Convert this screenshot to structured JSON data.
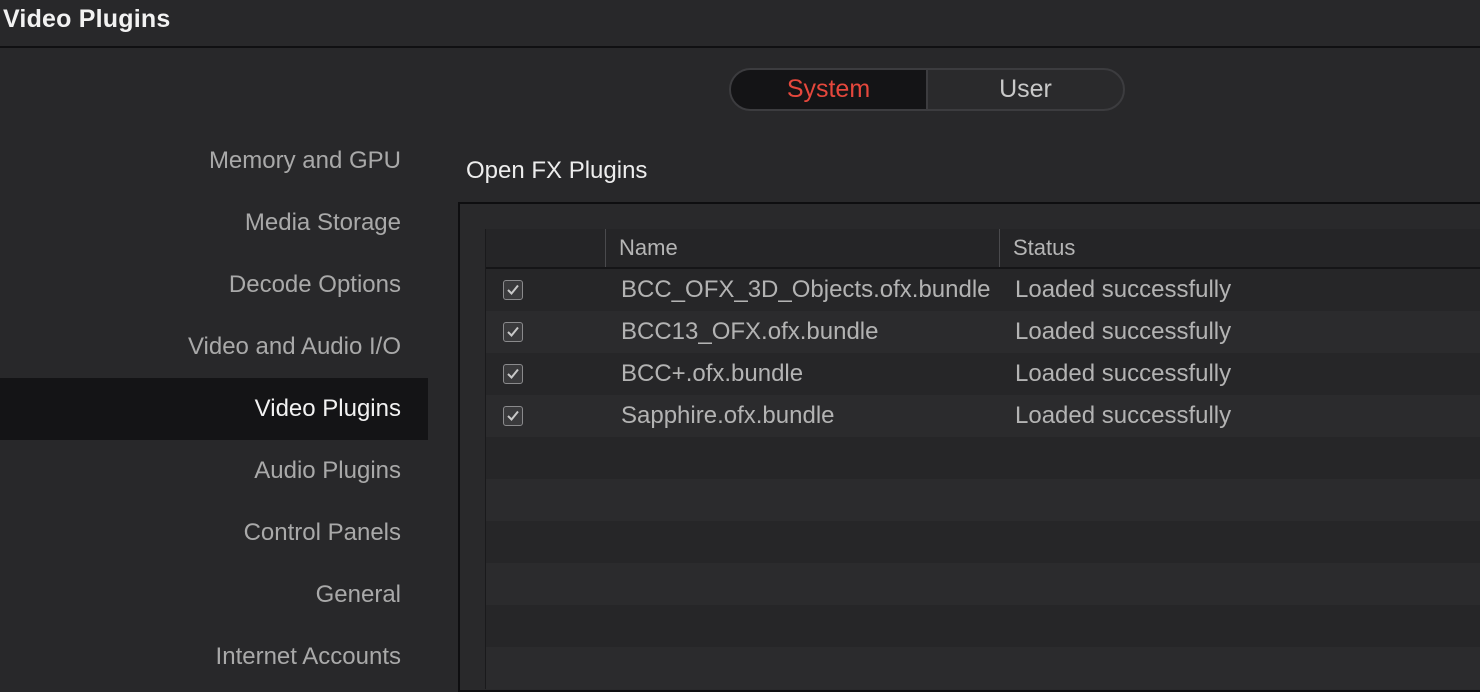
{
  "window": {
    "title": "Video Plugins"
  },
  "tabs": [
    {
      "label": "System",
      "active": true
    },
    {
      "label": "User",
      "active": false
    }
  ],
  "sidebar": {
    "items": [
      {
        "label": "Memory and GPU"
      },
      {
        "label": "Media Storage"
      },
      {
        "label": "Decode Options"
      },
      {
        "label": "Video and Audio I/O"
      },
      {
        "label": "Video Plugins",
        "active": true
      },
      {
        "label": "Audio Plugins"
      },
      {
        "label": "Control Panels"
      },
      {
        "label": "General"
      },
      {
        "label": "Internet Accounts"
      }
    ]
  },
  "section": {
    "title": "Open FX Plugins"
  },
  "table": {
    "columns": [
      "Name",
      "Status"
    ],
    "rows": [
      {
        "checked": true,
        "name": "BCC_OFX_3D_Objects.ofx.bundle",
        "status": "Loaded successfully"
      },
      {
        "checked": true,
        "name": "BCC13_OFX.ofx.bundle",
        "status": "Loaded successfully"
      },
      {
        "checked": true,
        "name": "BCC+.ofx.bundle",
        "status": "Loaded successfully"
      },
      {
        "checked": true,
        "name": "Sapphire.ofx.bundle",
        "status": "Loaded successfully"
      }
    ]
  },
  "colors": {
    "accent_active_tab": "#e5473c",
    "selected_sidebar_bg": "#141416"
  }
}
